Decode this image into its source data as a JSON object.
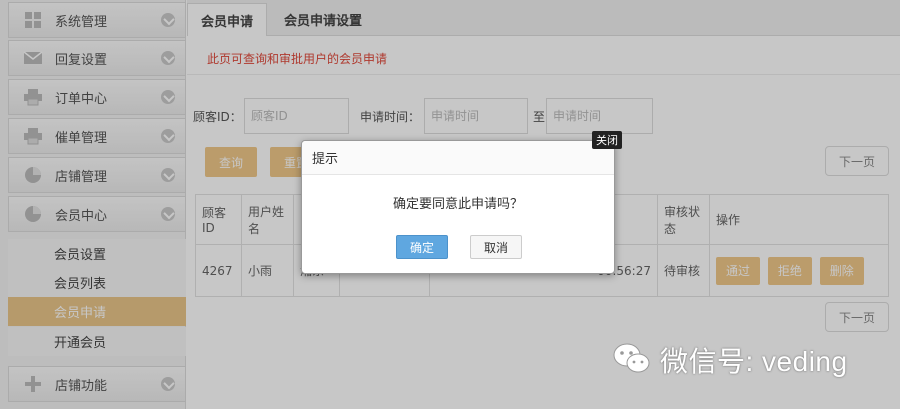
{
  "sidebar": {
    "items": [
      {
        "label": "系统管理",
        "icon": "grid-icon"
      },
      {
        "label": "回复设置",
        "icon": "mail-icon"
      },
      {
        "label": "订单中心",
        "icon": "printer-icon"
      },
      {
        "label": "催单管理",
        "icon": "printer-icon"
      },
      {
        "label": "店铺管理",
        "icon": "pie-chart-icon"
      },
      {
        "label": "会员中心",
        "icon": "pie-chart-icon"
      }
    ],
    "sub_items": [
      {
        "label": "会员设置",
        "active": false
      },
      {
        "label": "会员列表",
        "active": false
      },
      {
        "label": "会员申请",
        "active": true
      },
      {
        "label": "开通会员",
        "active": false
      }
    ],
    "bottom_item": {
      "label": "店铺功能",
      "icon": "plus-icon"
    }
  },
  "tabs": [
    {
      "label": "会员申请",
      "active": true
    },
    {
      "label": "会员申请设置",
      "active": false
    }
  ],
  "notice": "此页可查询和审批用户的会员申请",
  "filters": {
    "customer_id_label": "顾客ID：",
    "customer_id_placeholder": "顾客ID",
    "apply_time_label": "申请时间：",
    "apply_time_placeholder": "申请时间",
    "to_label": "至",
    "apply_time_end_placeholder": "申请时间"
  },
  "buttons": {
    "query": "查询",
    "reset": "重置",
    "next_page": "下一页"
  },
  "table": {
    "headers": [
      "顾客ID",
      "用户姓名",
      "",
      "",
      "",
      "审核状态",
      "操作"
    ],
    "rows": [
      {
        "id": "4267",
        "name": "小雨",
        "col3": "湘东",
        "col4": "",
        "col5": "",
        "time": "00:56:27",
        "status": "待审核",
        "actions": [
          "通过",
          "拒绝",
          "删除"
        ]
      }
    ]
  },
  "modal": {
    "title": "提示",
    "close_tip": "关闭",
    "message": "确定要同意此申请吗？",
    "ok": "确定",
    "cancel": "取消"
  },
  "watermark": "微信号: veding",
  "colors": {
    "accent": "#f0c88a",
    "active_nav": "#e9c68a",
    "notice_red": "#e04a3c",
    "ok_blue": "#5fa7e0"
  }
}
